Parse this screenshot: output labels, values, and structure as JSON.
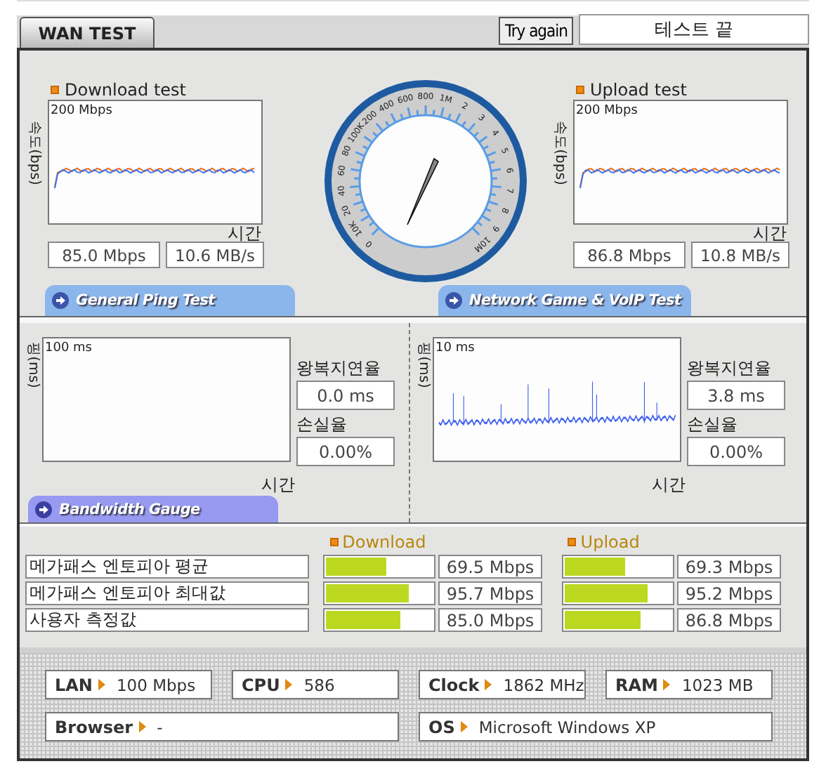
{
  "tab": {
    "label": "WAN TEST",
    "selected": true
  },
  "try_again": "Try again",
  "status": "테스트 끝",
  "speed_tests": [
    {
      "title": "Download test",
      "y_label": "속도(bps)",
      "scale": "200 Mbps",
      "x_label": "시간",
      "mbps": "85.0 Mbps",
      "mbs": "10.6 MB/s"
    },
    {
      "title": "Upload test",
      "y_label": "속도(bps)",
      "scale": "200 Mbps",
      "x_label": "시간",
      "mbps": "86.8 Mbps",
      "mbs": "10.8 MB/s"
    }
  ],
  "gauge": {
    "labels": [
      "0",
      "10K",
      "20",
      "40",
      "60",
      "80",
      "100K",
      "200",
      "400",
      "600",
      "800",
      "1M",
      "2",
      "3",
      "4",
      "5",
      "6",
      "7",
      "8",
      "9",
      "10M"
    ]
  },
  "ping_headers": [
    "General Ping Test",
    "Network Game & VoIP Test"
  ],
  "ping": [
    {
      "y_label": "핑(ms)",
      "scale": "100 ms",
      "x_label": "시간",
      "trace": false,
      "rtt_label": "왕복지연율",
      "rtt": "0.0 ms",
      "loss_label": "손실율",
      "loss": "0.00%"
    },
    {
      "y_label": "핑(ms)",
      "scale": "10 ms",
      "x_label": "시간",
      "trace": true,
      "rtt_label": "왕복지연율",
      "rtt": "3.8 ms",
      "loss_label": "손실율",
      "loss": "0.00%"
    }
  ],
  "bandwidth_header": "Bandwidth Gauge",
  "bandwidth": {
    "columns": [
      "Download",
      "Upload"
    ],
    "rows": [
      {
        "label": "메가패스 엔토피아 평균",
        "download": {
          "level": 0.56,
          "value": "69.5 Mbps"
        },
        "upload": {
          "level": 0.56,
          "value": "69.3 Mbps"
        }
      },
      {
        "label": "메가패스 엔토피아 최대값",
        "download": {
          "level": 0.78,
          "value": "95.7 Mbps"
        },
        "upload": {
          "level": 0.78,
          "value": "95.2 Mbps"
        }
      },
      {
        "label": "사용자 측정값",
        "download": {
          "level": 0.7,
          "value": "85.0 Mbps"
        },
        "upload": {
          "level": 0.71,
          "value": "86.8 Mbps"
        }
      }
    ]
  },
  "system": [
    {
      "label": "LAN",
      "value": "100 Mbps",
      "wide": false
    },
    {
      "label": "CPU",
      "value": "586",
      "wide": false
    },
    {
      "label": "Clock",
      "value": "1862 MHz",
      "wide": false
    },
    {
      "label": "RAM",
      "value": "1023 MB",
      "wide": false
    },
    {
      "label": "Browser",
      "value": "-",
      "wide": true
    },
    {
      "label": "OS",
      "value": "Microsoft Windows XP",
      "wide": true
    }
  ]
}
